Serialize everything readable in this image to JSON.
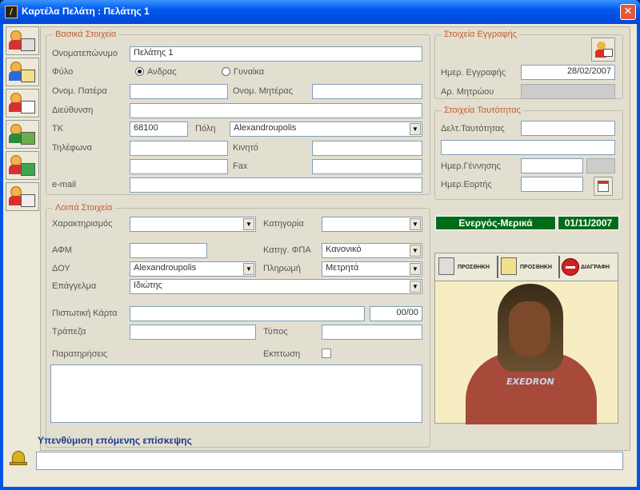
{
  "window": {
    "title": "Καρτέλα Πελάτη : Πελάτης 1",
    "close": "✕"
  },
  "basic": {
    "legend": "Βασικά Στοιχεία",
    "fullname_label": "Ονοματεπώνυμο",
    "fullname": "Πελάτης 1",
    "gender_label": "Φύλο",
    "male": "Ανδρας",
    "female": "Γυναίκα",
    "father_label": "Ονομ. Πατέρα",
    "mother_label": "Ονομ. Μητέρας",
    "address_label": "Διεύθυνση",
    "zip_label": "ΤΚ",
    "zip": "68100",
    "city_label": "Πόλη",
    "city": "Alexandroupolis",
    "phones_label": "Τηλέφωνα",
    "mobile_label": "Κινητό",
    "fax_label": "Fax",
    "email_label": "e-mail"
  },
  "other": {
    "legend": "Λοιπά Στοιχεία",
    "char_label": "Χαρακτηρισμός",
    "cat_label": "Κατηγορία",
    "afm_label": "ΑΦΜ",
    "vat_label": "Κατηγ. ΦΠΑ",
    "vat": "Κανονικό",
    "doy_label": "ΔΟΥ",
    "doy": "Alexandroupolis",
    "pay_label": "Πληρωμή",
    "pay": "Μετρητά",
    "job_label": "Επάγγελμα",
    "job": "Ιδιώτης",
    "card_label": "Πιστωτική Κάρτα",
    "card_exp": "00/00",
    "bank_label": "Τράπεζα",
    "type_label": "Τύπος",
    "notes_label": "Παρατηρήσεις",
    "discount_label": "Εκπτωση"
  },
  "reg": {
    "legend": "Στοιχεία Εγγραφής",
    "date_label": "Ημερ. Εγγραφής",
    "date": "28/02/2007",
    "reg_no_label": "Αρ. Μητρώου"
  },
  "id": {
    "legend": "Στοιχεία Ταυτότητας",
    "id_label": "Δελτ.Ταυτότητας",
    "birth_label": "Ημερ.Γέννησης",
    "name_day_label": "Ημερ.Εορτής"
  },
  "status": {
    "text": "Ενεργός-Μερικά",
    "date": "01/11/2007",
    "color": "#006c1a"
  },
  "photo_toolbar": {
    "add1": "ΠΡΟΣΘΗΚΗ",
    "add2": "ΠΡΟΣΘΗΚΗ",
    "delete": "ΔΙΑΓΡΑΦΗ"
  },
  "photo": {
    "logo": "EXEDRON"
  },
  "reminder": {
    "label": "Υπενθύμιση επόμενης επίσκεψης"
  },
  "sidebar": {
    "items": [
      "customer-card-icon",
      "customer-edit-icon",
      "customer-id-icon",
      "customer-money-icon",
      "customer-card-payment-icon",
      "customer-list-icon"
    ]
  }
}
